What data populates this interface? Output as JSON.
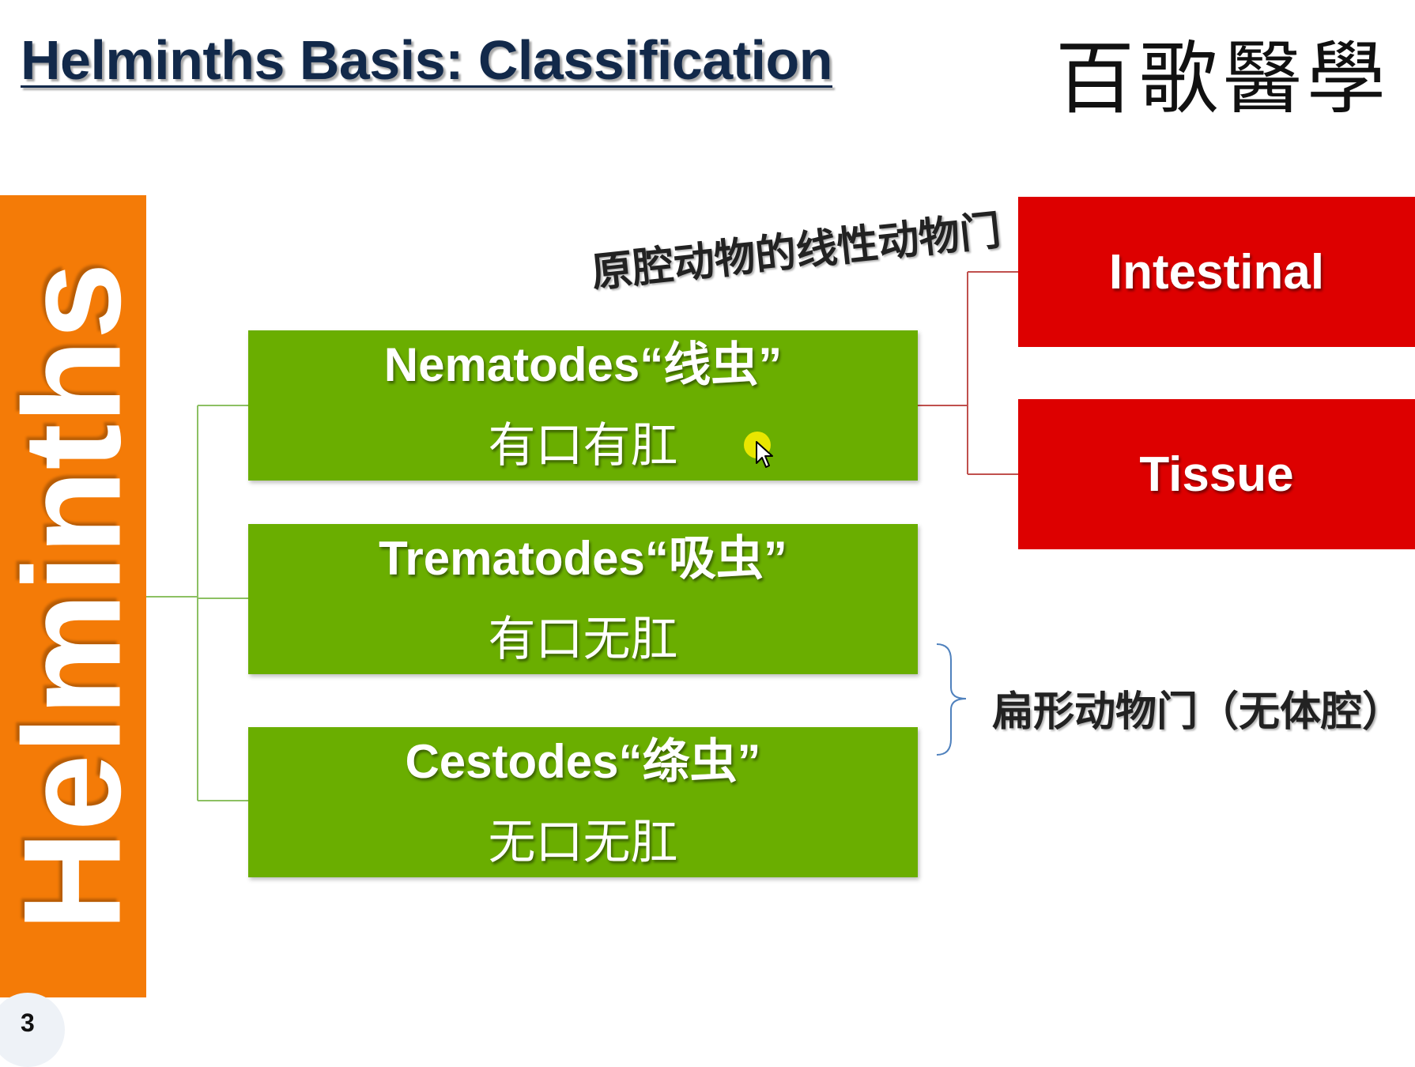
{
  "slide": {
    "title": "Helminths Basis: Classification",
    "logo_text": "百歌醫學",
    "root_label": "Helminths",
    "page_number": "3"
  },
  "groups": [
    {
      "name": "Nematodes“线虫”",
      "feature": "有口有肛"
    },
    {
      "name": "Trematodes“吸虫”",
      "feature": "有口无肛"
    },
    {
      "name": "Cestodes“绦虫”",
      "feature": "无口无肛"
    }
  ],
  "nematode_types": [
    "Intestinal",
    "Tissue"
  ],
  "annotations": {
    "nematode_phylum": "原腔动物的线性动物门",
    "flatworm_phylum": "扁形动物门（无体腔）"
  },
  "colors": {
    "title": "#12294a",
    "root_bar": "#f47b07",
    "group_box": "#6aae00",
    "type_box": "#dd0000",
    "brace": "#4f81bd"
  },
  "icons": [
    "cursor-highlight-icon",
    "mouse-pointer-icon"
  ]
}
